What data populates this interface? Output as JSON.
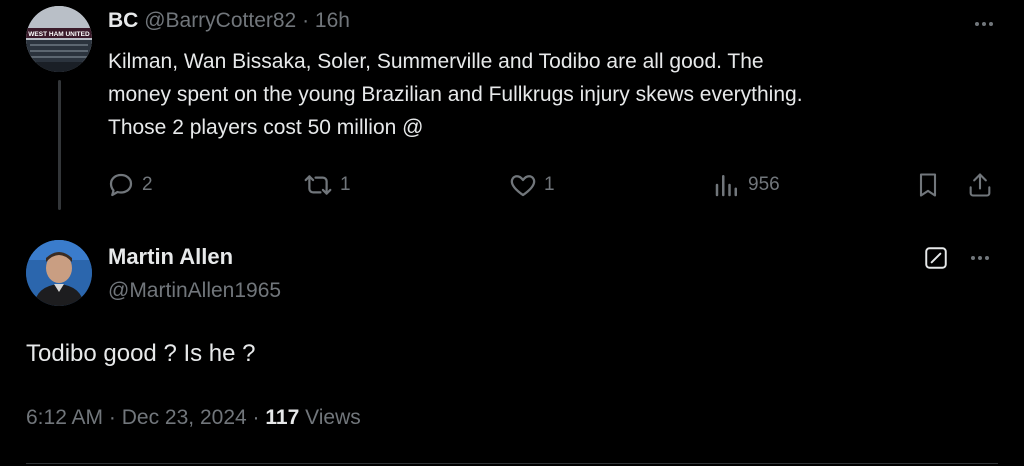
{
  "parent_post": {
    "author_name": "BC",
    "handle": "@BarryCotter82",
    "separator": "·",
    "time_ago": "16h",
    "avatar_text": "WEST HAM UNITED",
    "text_lines": [
      "Kilman, Wan Bissaka, Soler, Summerville and Todibo are all good. The",
      "money spent on the young Brazilian and Fullkrugs injury skews everything.",
      "Those 2 players cost 50 million @"
    ],
    "actions": {
      "reply_count": "2",
      "repost_count": "1",
      "like_count": "1",
      "views_count": "956"
    },
    "icons": [
      "reply-icon",
      "repost-icon",
      "like-icon",
      "views-icon",
      "bookmark-icon",
      "share-icon",
      "more-icon"
    ]
  },
  "reply_post": {
    "author_name": "Martin Allen",
    "handle": "@MartinAllen1965",
    "text": "Todibo good ? Is he ?",
    "time": "6:12 AM",
    "separator1": "·",
    "date": "Dec 23, 2024",
    "separator2": "·",
    "views_count": "117",
    "views_label": "Views",
    "icons": [
      "grok-icon",
      "more-icon"
    ]
  },
  "colors": {
    "background": "#000000",
    "primary_text": "#e7e9ea",
    "secondary_text": "#71767b",
    "divider": "#2f3336"
  }
}
